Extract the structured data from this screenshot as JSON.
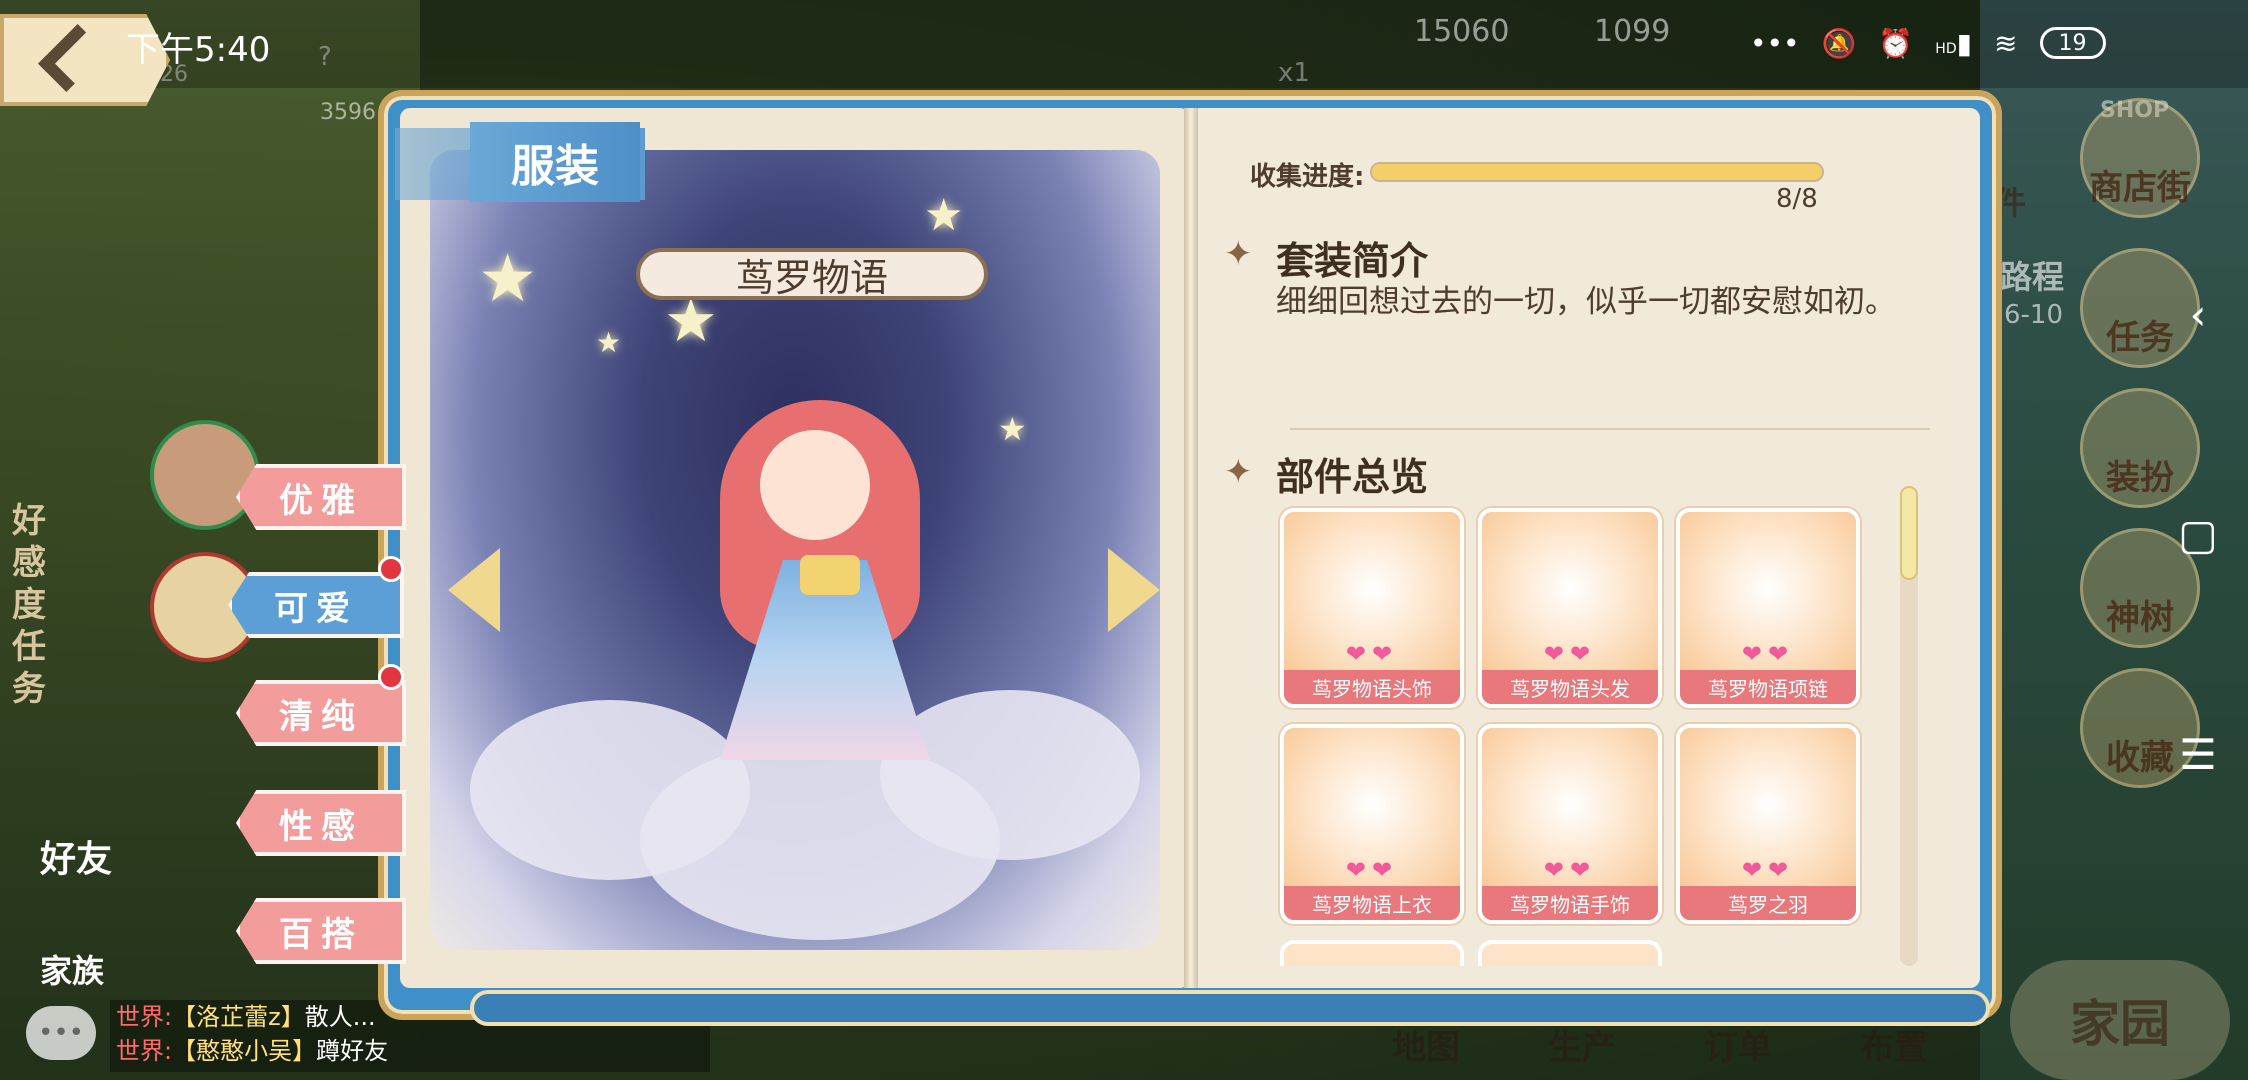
{
  "status_bar": {
    "time": "下午5:40",
    "network": "HD",
    "battery": "19"
  },
  "background_resources": {
    "coins": "15060",
    "gems": "1099",
    "level": "26",
    "exp": "3596",
    "multiplier": "x1",
    "question": "?"
  },
  "book": {
    "header_title": "服装",
    "suit_name": "茑罗物语",
    "categories": [
      {
        "label": "优雅",
        "active": false,
        "dot": false
      },
      {
        "label": "可爱",
        "active": true,
        "dot": true
      },
      {
        "label": "清纯",
        "active": false,
        "dot": true
      },
      {
        "label": "性感",
        "active": false,
        "dot": false
      },
      {
        "label": "百搭",
        "active": false,
        "dot": false
      }
    ],
    "progress": {
      "label": "收集进度:",
      "count": "8/8",
      "fraction": 1.0
    },
    "intro": {
      "title": "套装简介",
      "text": "细细回想过去的一切，似乎一切都安慰如初。"
    },
    "parts": {
      "title": "部件总览",
      "items": [
        {
          "label": "茑罗物语头饰",
          "hearts": "❤❤"
        },
        {
          "label": "茑罗物语头发",
          "hearts": "❤❤"
        },
        {
          "label": "茑罗物语项链",
          "hearts": "❤❤"
        },
        {
          "label": "茑罗物语上衣",
          "hearts": "❤❤"
        },
        {
          "label": "茑罗物语手饰",
          "hearts": "❤❤"
        },
        {
          "label": "茑罗之羽",
          "hearts": "❤❤"
        }
      ]
    }
  },
  "right_menu": [
    "商店街",
    "任务",
    "装扮",
    "神树",
    "收藏"
  ],
  "right_menu_shop_tag": "SHOP",
  "right_partial": {
    "text1": "件",
    "text2": "路程",
    "text3": "6-10"
  },
  "left_panel": {
    "vertical": "好感度任务",
    "friends": "好友",
    "family": "家族"
  },
  "bottom_tabs": [
    "地图",
    "生产",
    "订单",
    "布置"
  ],
  "bottom_home": "家园",
  "chat": [
    {
      "channel": "世界:",
      "name": "【洛芷蕾z】",
      "text": "散人..."
    },
    {
      "channel": "世界:",
      "name": "【憨憨小吴】",
      "text": "蹲好友"
    }
  ]
}
